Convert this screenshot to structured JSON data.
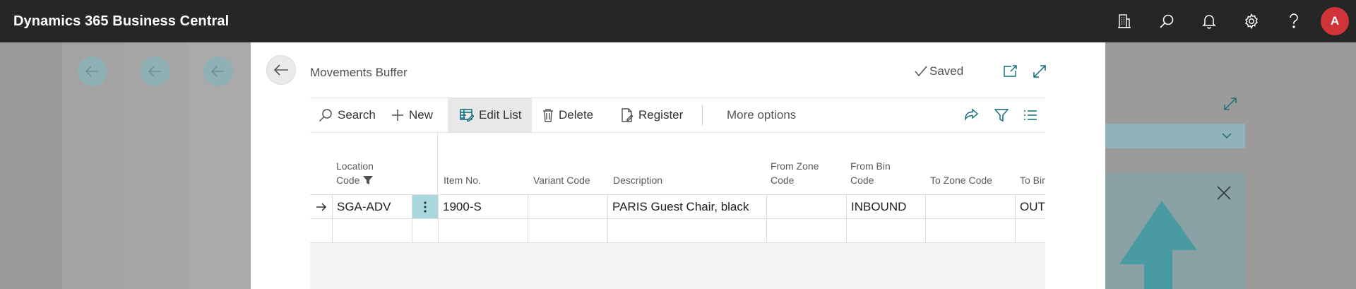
{
  "app": {
    "title": "Dynamics 365 Business Central",
    "avatar_letter": "A"
  },
  "appbar_icons": [
    "office-building-icon",
    "search-icon",
    "bell-icon",
    "gear-icon",
    "help-icon"
  ],
  "dialog": {
    "title": "Movements Buffer",
    "status": "Saved"
  },
  "actions": {
    "search": "Search",
    "new": "New",
    "edit_list": "Edit List",
    "delete": "Delete",
    "register": "Register",
    "more_options": "More options"
  },
  "columns": {
    "location_code_1": "Location",
    "location_code_2": "Code",
    "item_no": "Item No.",
    "variant_code": "Variant Code",
    "description": "Description",
    "from_zone_1": "From Zone",
    "from_zone_2": "Code",
    "from_bin_1": "From Bin",
    "from_bin_2": "Code",
    "to_zone": "To Zone Code",
    "to_bin": "To Bin"
  },
  "rows": [
    {
      "location_code": "SGA-ADV",
      "item_no": "1900-S",
      "variant_code": "",
      "description": "PARIS Guest Chair, black",
      "from_zone_code": "",
      "from_bin_code": "INBOUND",
      "to_zone_code": "",
      "to_bin_code": "OUTBOUND"
    }
  ],
  "colors": {
    "appbar": "#262626",
    "accent": "#00838f",
    "avatar": "#d13438",
    "selected_cell": "#a9d7dd"
  }
}
